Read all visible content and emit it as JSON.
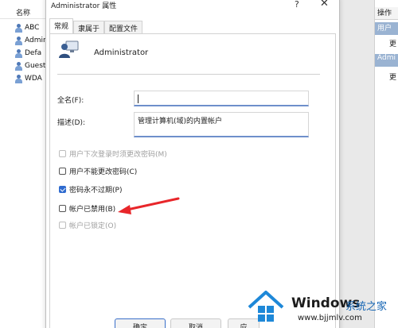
{
  "background": {
    "list": {
      "column_header": "名称",
      "items": [
        "ABC",
        "Admini",
        "Defa",
        "Guest",
        "WDA"
      ]
    },
    "actions": {
      "header": "操作",
      "section1": "用户",
      "item1": "更",
      "section2": "Admi",
      "item2": "更"
    }
  },
  "dialog": {
    "title": "Administrator 属性",
    "help_icon": "?",
    "close_icon": "✕",
    "tabs": [
      "常规",
      "隶属于",
      "配置文件"
    ],
    "active_tab": 0,
    "username": "Administrator",
    "fields": {
      "fullname_label": "全名(F):",
      "fullname_value": "",
      "description_label": "描述(D):",
      "description_value": "管理计算机(域)的内置帐户"
    },
    "checkboxes": [
      {
        "label": "用户下次登录时须更改密码(M)",
        "checked": false,
        "disabled": true
      },
      {
        "label": "用户不能更改密码(C)",
        "checked": false,
        "disabled": false
      },
      {
        "label": "密码永不过期(P)",
        "checked": true,
        "disabled": false
      },
      {
        "label": "帐户已禁用(B)",
        "checked": false,
        "disabled": false
      },
      {
        "label": "帐户已锁定(O)",
        "checked": false,
        "disabled": true
      }
    ],
    "buttons": {
      "ok": "确定",
      "cancel": "取消",
      "apply": "应"
    }
  },
  "watermark": {
    "brand": "Windows",
    "brand_cn": "系统之家",
    "url": "www.bjjmlv.com"
  },
  "colors": {
    "accent": "#2f6bcf",
    "annotation_arrow": "#e8262a"
  }
}
